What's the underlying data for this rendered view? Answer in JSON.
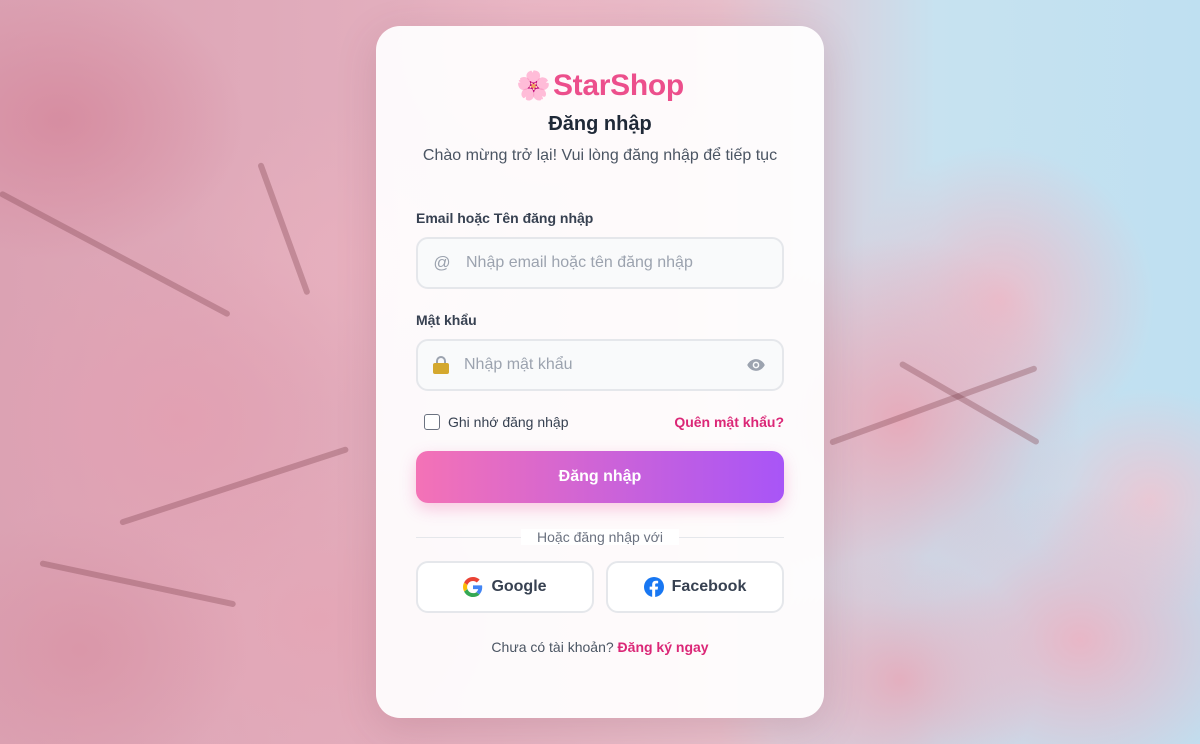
{
  "brand": {
    "icon": "cherry-blossom-icon",
    "emoji": "🌸",
    "name": "StarShop",
    "color": "#ec4f8c"
  },
  "title": "Đăng nhập",
  "subtitle": "Chào mừng trở lại! Vui lòng đăng nhập để tiếp tục",
  "email": {
    "label": "Email hoặc Tên đăng nhập",
    "icon": "at-icon",
    "icon_glyph": "@",
    "placeholder": "Nhập email hoặc tên đăng nhập",
    "value": ""
  },
  "password": {
    "label": "Mật khẩu",
    "icon": "lock-icon",
    "placeholder": "Nhập mật khẩu",
    "value": "",
    "toggle_icon": "eye-icon"
  },
  "remember": {
    "label": "Ghi nhớ đăng nhập",
    "checked": false
  },
  "forgot": "Quên mật khẩu?",
  "submit": "Đăng nhập",
  "divider": "Hoặc đăng nhập với",
  "social": {
    "google": "Google",
    "facebook": "Facebook"
  },
  "signup": {
    "prompt": "Chưa có tài khoản?",
    "link": "Đăng ký ngay"
  },
  "colors": {
    "accent": "#db2777",
    "gradient_start": "#f472b6",
    "gradient_end": "#a855f7"
  }
}
